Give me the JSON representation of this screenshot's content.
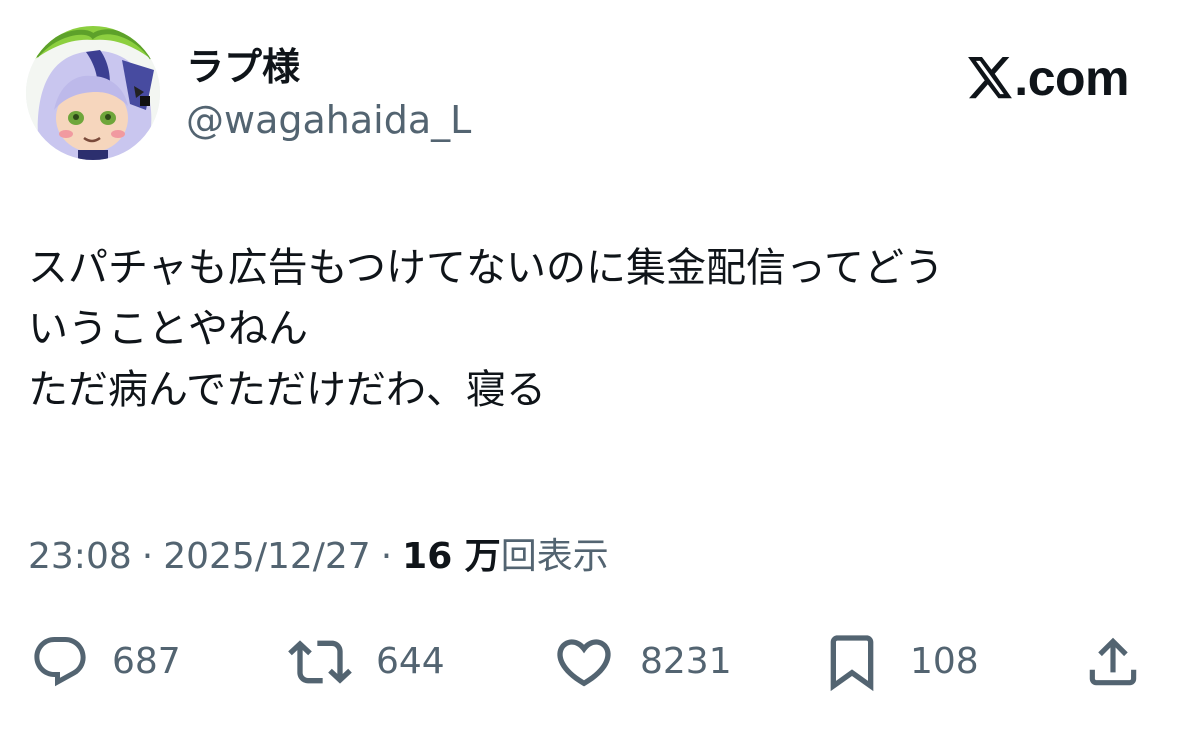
{
  "user": {
    "display_name": "ラプ様",
    "handle": "@wagahaida_L",
    "avatar_icon": "character-avatar"
  },
  "brand": {
    "label": ".com",
    "icon": "x-logo-icon"
  },
  "tweet": {
    "lines": [
      "スパチャも広告もつけてないのに集金配信ってどう",
      "いうことやねん",
      "ただ病んでただけだわ、寝る"
    ]
  },
  "meta": {
    "time": "23:08",
    "separator": "·",
    "date": "2025/12/27",
    "views_count": "16 万",
    "views_label": "回表示"
  },
  "actions": {
    "reply": {
      "icon": "reply-icon",
      "count": "687"
    },
    "repost": {
      "icon": "repost-icon",
      "count": "644"
    },
    "like": {
      "icon": "heart-icon",
      "count": "8231"
    },
    "bookmark": {
      "icon": "bookmark-icon",
      "count": "108"
    },
    "share": {
      "icon": "share-icon"
    }
  },
  "colors": {
    "text": "#0f1419",
    "secondary": "#536471",
    "background": "#ffffff"
  }
}
